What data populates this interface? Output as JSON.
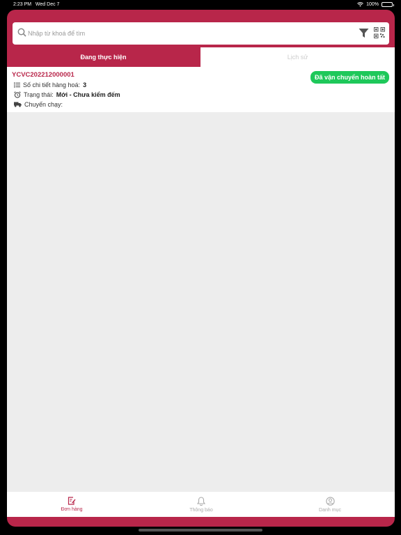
{
  "status_bar": {
    "time": "2:23 PM",
    "date": "Wed Dec 7",
    "battery": "100%"
  },
  "search": {
    "placeholder": "Nhập từ khoá để tìm"
  },
  "tabs": [
    {
      "label": "Đang thực hiện"
    },
    {
      "label": "Lịch sử"
    }
  ],
  "order": {
    "code": "YCVC202212000001",
    "status_badge": "Đã vận chuyển hoàn tất",
    "detail_label": "Số chi tiết hàng hoá:",
    "detail_value": "3",
    "state_label": "Trạng thái:",
    "state_value": "Mới - Chưa kiểm đếm",
    "trip_label": "Chuyến chạy:"
  },
  "nav": [
    {
      "label": "Đơn hàng"
    },
    {
      "label": "Thông báo"
    },
    {
      "label": "Danh mục"
    }
  ],
  "colors": {
    "primary": "#b8264a",
    "success": "#1ec85a",
    "background": "#ededed"
  }
}
